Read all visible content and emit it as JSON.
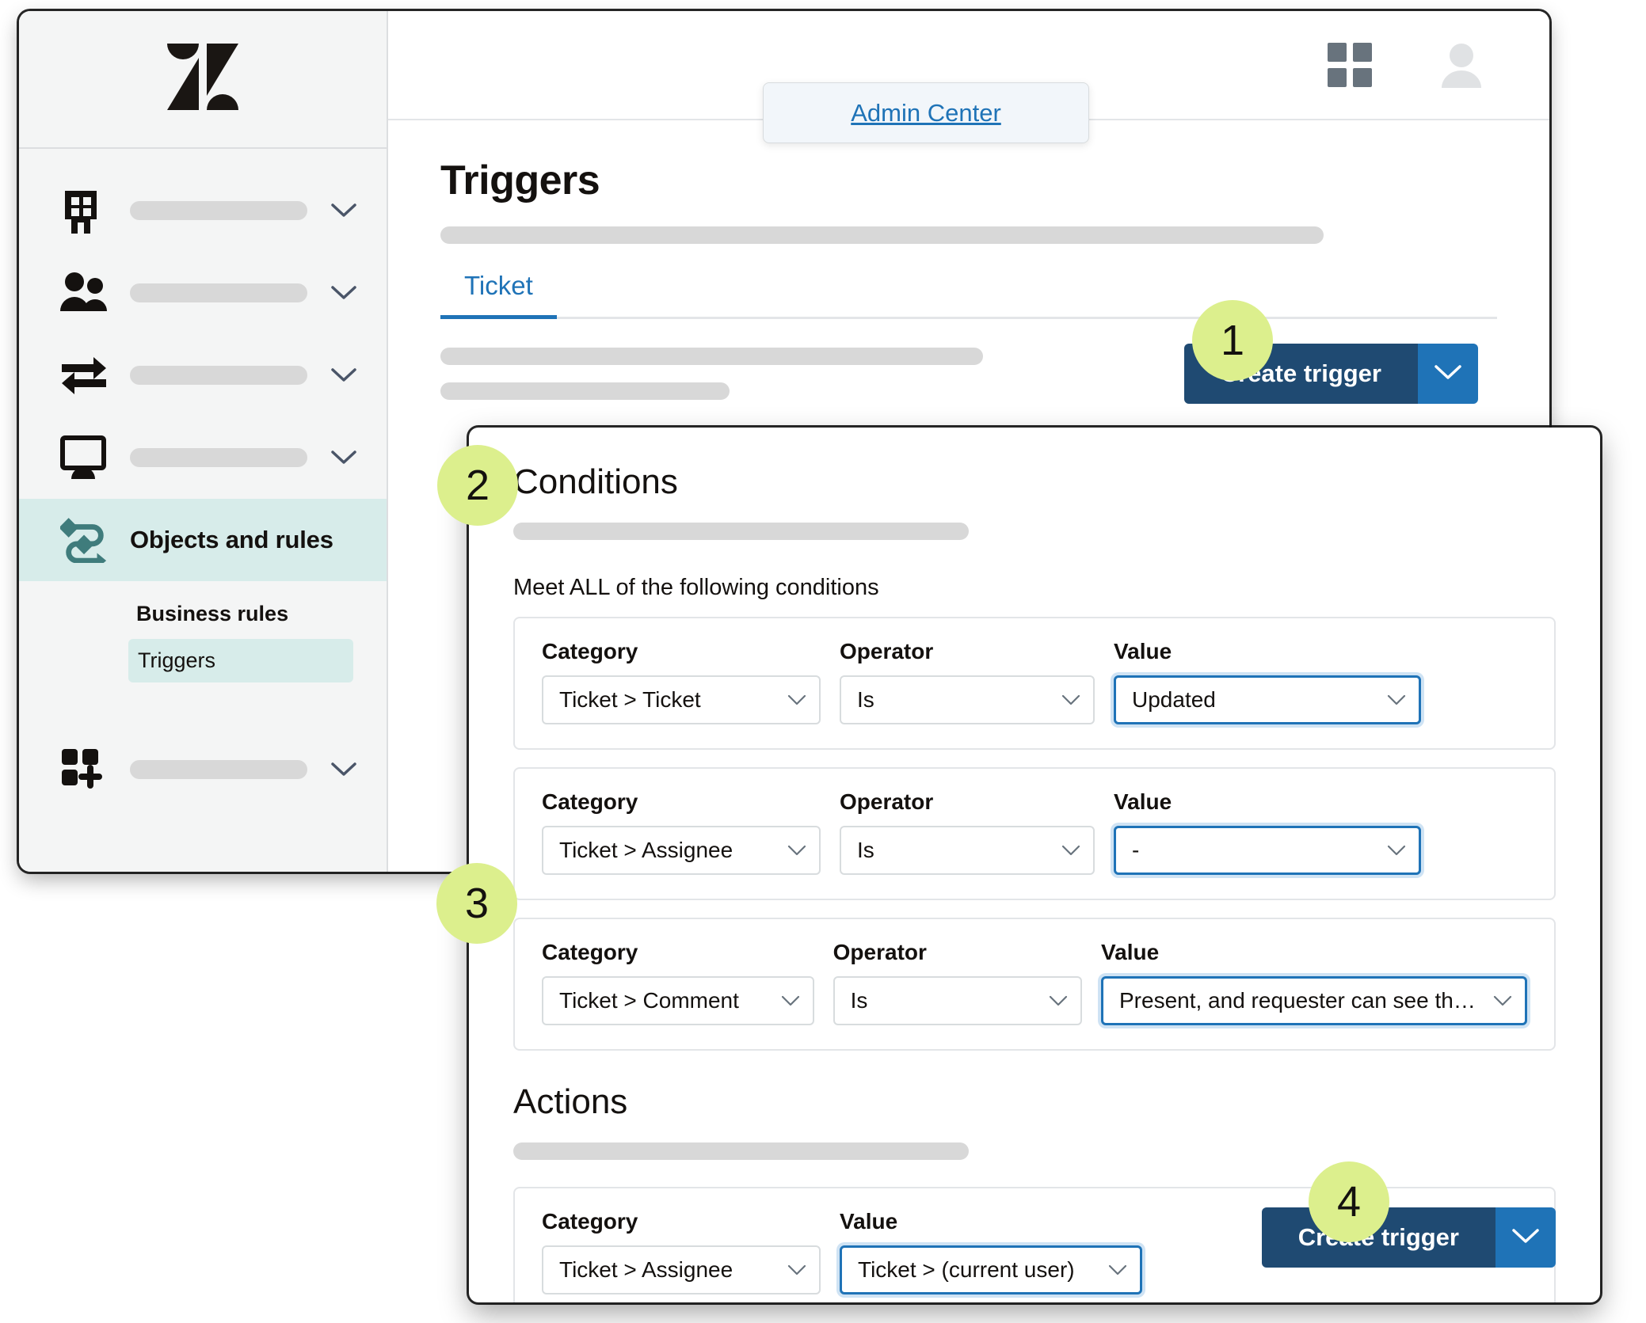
{
  "app": {
    "logo_icon": "zendesk-logo-icon"
  },
  "sidebar": {
    "nav_items": [
      {
        "icon": "building-icon",
        "label": "",
        "has_chevron": true
      },
      {
        "icon": "people-icon",
        "label": "",
        "has_chevron": true
      },
      {
        "icon": "transfer-arrows-icon",
        "label": "",
        "has_chevron": true
      },
      {
        "icon": "monitor-icon",
        "label": "",
        "has_chevron": true
      }
    ],
    "active_item": {
      "icon": "objects-and-rules-icon",
      "label": "Objects and rules"
    },
    "sub_heading": "Business rules",
    "sub_items": [
      {
        "label": "Triggers",
        "selected": true
      }
    ],
    "bottom_item": {
      "icon": "apps-add-icon",
      "label": "",
      "has_chevron": true
    }
  },
  "topbar": {
    "grid_icon": "grid-apps-icon",
    "avatar_icon": "user-avatar-icon",
    "popover_link": "Admin Center"
  },
  "page": {
    "title": "Triggers",
    "tabs": [
      {
        "label": "Ticket",
        "active": true
      }
    ],
    "create_button": {
      "label": "Create trigger",
      "caret_icon": "chevron-down-icon"
    }
  },
  "editor": {
    "conditions": {
      "title": "Conditions",
      "meet_text": "Meet ALL of the following conditions",
      "labels": {
        "category": "Category",
        "operator": "Operator",
        "value": "Value"
      },
      "rows": [
        {
          "category": "Ticket > Ticket",
          "operator": "Is",
          "value": "Updated",
          "value_focused": true
        },
        {
          "category": "Ticket > Assignee",
          "operator": "Is",
          "value": "-",
          "value_focused": true
        },
        {
          "category": "Ticket > Comment",
          "operator": "Is",
          "value": "Present, and requester can see the comment",
          "value_focused": true
        }
      ]
    },
    "actions": {
      "title": "Actions",
      "labels": {
        "category": "Category",
        "value": "Value"
      },
      "rows": [
        {
          "category": "Ticket > Assignee",
          "value": "Ticket > (current user)",
          "value_focused": true
        }
      ]
    },
    "create_button": {
      "label": "Create trigger",
      "caret_icon": "chevron-down-icon"
    }
  },
  "callouts": [
    {
      "number": "1"
    },
    {
      "number": "2"
    },
    {
      "number": "3"
    },
    {
      "number": "4"
    }
  ],
  "colors": {
    "callout_bg": "#dcef8d",
    "primary_button": "#1f4a72",
    "split_button": "#1f73b7",
    "link": "#1f73b7",
    "active_nav": "#d7ecea",
    "accent_teal": "#3f7c7c"
  }
}
